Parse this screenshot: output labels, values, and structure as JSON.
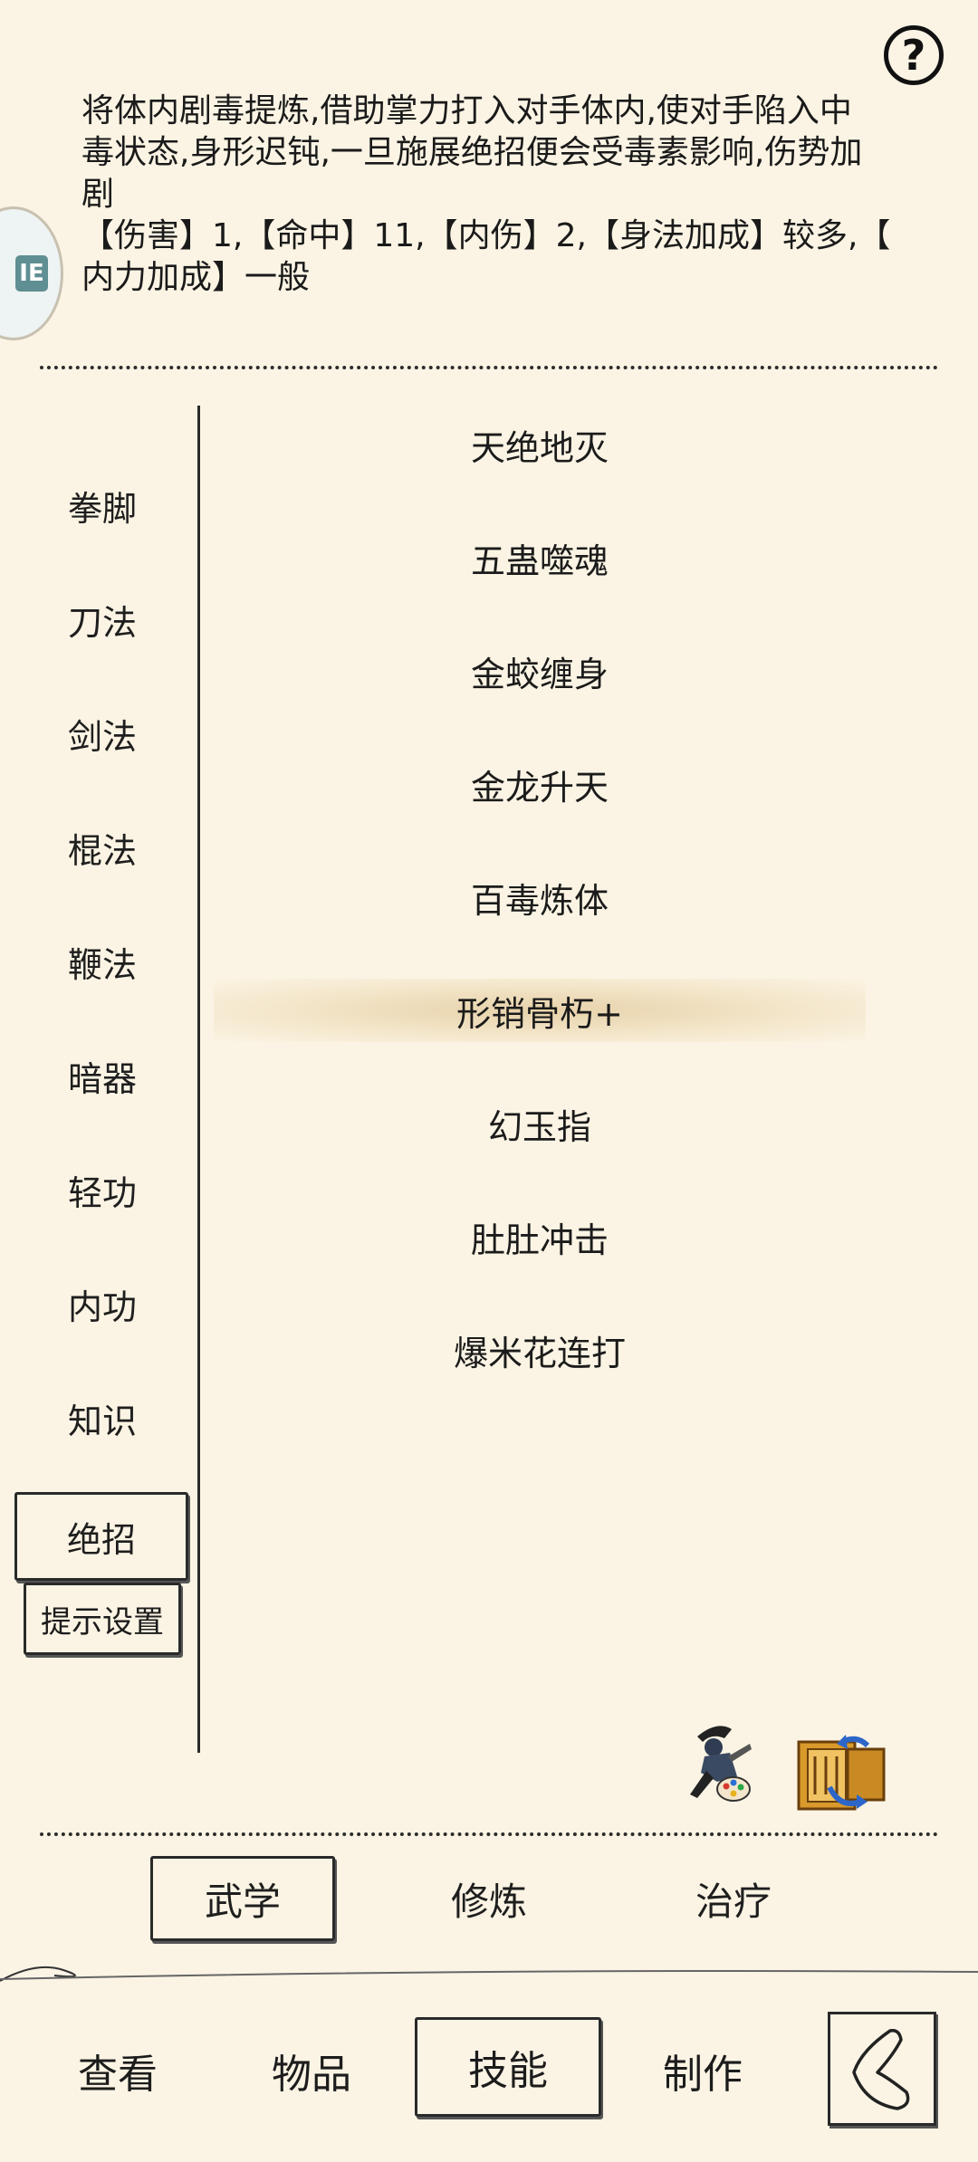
{
  "help": {
    "label": "?"
  },
  "side_badge": {
    "glyph": "IE"
  },
  "description": {
    "lines": [
      "将体内剧毒提炼,借助掌力打入对手体内,使对手陷入中",
      "毒状态,身形迟钝,一旦施展绝招便会受毒素影响,伤势加",
      "剧"
    ],
    "stats_lines": [
      "【伤害】1,【命中】11,【内伤】2,【身法加成】较多,【",
      "内力加成】一般"
    ]
  },
  "categories": [
    {
      "label": "拳脚"
    },
    {
      "label": "刀法"
    },
    {
      "label": "剑法"
    },
    {
      "label": "棍法"
    },
    {
      "label": "鞭法"
    },
    {
      "label": "暗器"
    },
    {
      "label": "轻功"
    },
    {
      "label": "内功"
    },
    {
      "label": "知识"
    },
    {
      "label": "绝招",
      "selected": true
    }
  ],
  "tip_settings": {
    "label": "提示设置"
  },
  "skills": [
    {
      "label": "天绝地灭"
    },
    {
      "label": "五蛊噬魂"
    },
    {
      "label": "金蛟缠身"
    },
    {
      "label": "金龙升天"
    },
    {
      "label": "百毒炼体"
    },
    {
      "label": "形销骨朽+",
      "active": true
    },
    {
      "label": "幻玉指"
    },
    {
      "label": "肚肚冲击"
    },
    {
      "label": "爆米花连打"
    }
  ],
  "tool_icons": {
    "left": "ninja-painter-icon",
    "right": "scroll-swap-icon"
  },
  "sub_tabs": [
    {
      "label": "武学",
      "selected": true
    },
    {
      "label": "修炼"
    },
    {
      "label": "治疗"
    }
  ],
  "bottom_nav": [
    {
      "label": "查看"
    },
    {
      "label": "物品"
    },
    {
      "label": "技能",
      "selected": true
    },
    {
      "label": "制作"
    }
  ],
  "back_icon": "back-arrow-icon",
  "colors": {
    "background": "#fbf4e4",
    "ink": "#1c1c1c",
    "highlight": "#e0c696"
  }
}
